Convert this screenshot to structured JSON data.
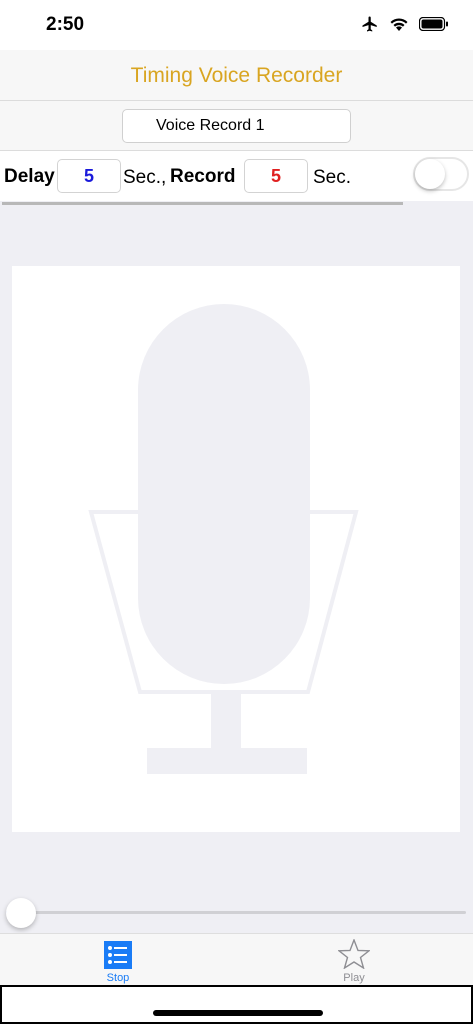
{
  "status_bar": {
    "time": "2:50"
  },
  "nav": {
    "title": "Timing Voice Recorder"
  },
  "record": {
    "name": "Voice Record 1"
  },
  "timing": {
    "delay_label": "Delay",
    "delay_value": "5",
    "sec_comma": "Sec.,",
    "record_label": "Record",
    "record_value": "5",
    "sec": "Sec.",
    "toggle_on": false
  },
  "colors": {
    "title": "#d9a521",
    "delay_value": "#1a1adb",
    "record_value": "#e02020",
    "tab_active": "#1a7cf6",
    "tab_inactive": "#8e8e93"
  },
  "playback": {
    "position_fraction": 0.0
  },
  "tabs": [
    {
      "label": "Stop",
      "icon": "list-icon",
      "active": true
    },
    {
      "label": "Play",
      "icon": "star-icon",
      "active": false
    }
  ]
}
